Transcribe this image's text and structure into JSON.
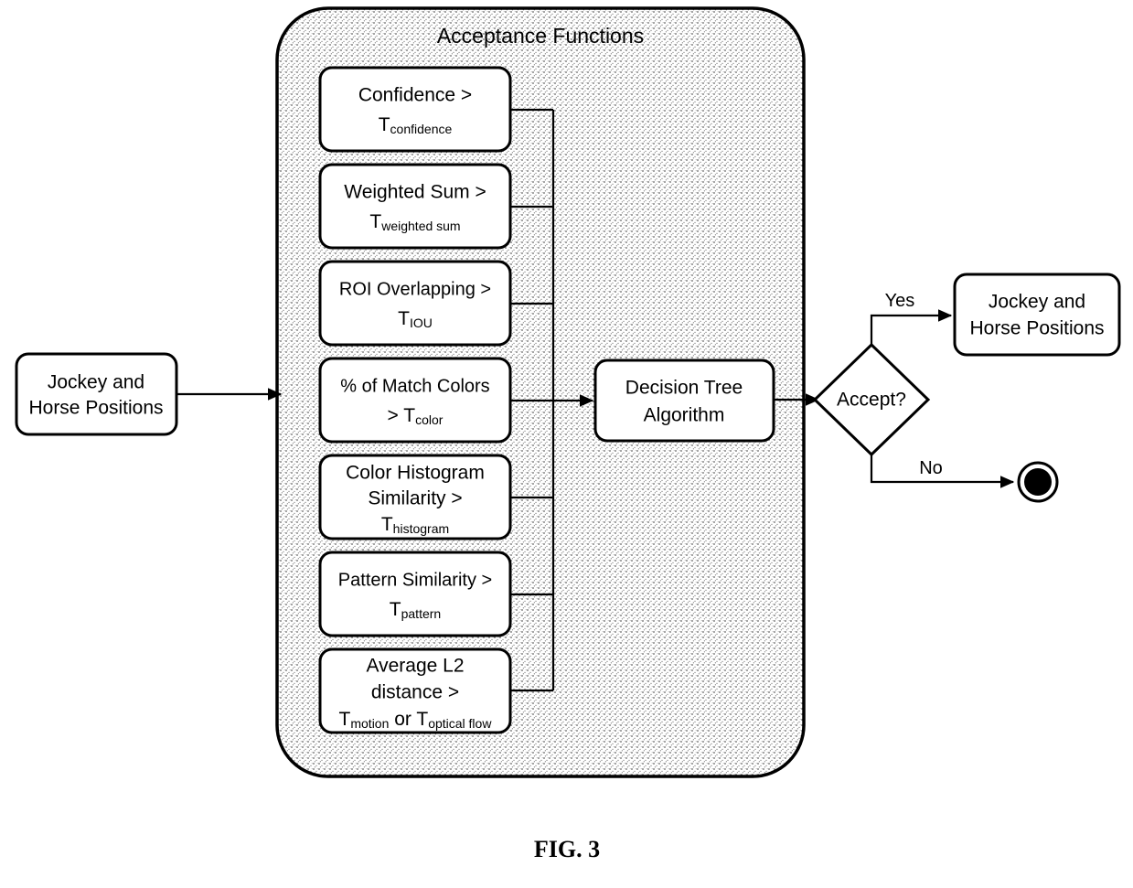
{
  "figure": {
    "caption": "FIG. 3",
    "colors": {
      "stroke": "#000000",
      "background": "#ffffff",
      "container_fill": "#e8e8e8"
    }
  },
  "input_node": {
    "name": "jockey-horse-positions-input",
    "lines": [
      "Jockey and",
      "Horse Positions"
    ]
  },
  "group": {
    "title": "Acceptance Functions",
    "functions": [
      {
        "id": "confidence",
        "lines": [
          {
            "text": "Confidence >",
            "sub": ""
          },
          {
            "text": "T",
            "sub": "confidence"
          }
        ]
      },
      {
        "id": "weighted-sum",
        "lines": [
          {
            "text": "Weighted Sum >",
            "sub": ""
          },
          {
            "text": "T",
            "sub": "weighted sum"
          }
        ]
      },
      {
        "id": "roi-overlapping",
        "lines": [
          {
            "text": "ROI Overlapping >",
            "sub": ""
          },
          {
            "text": "T",
            "sub": "IOU"
          }
        ]
      },
      {
        "id": "match-colors",
        "lines": [
          {
            "text": "% of Match Colors",
            "sub": ""
          },
          {
            "text": "> T",
            "sub": "color"
          }
        ]
      },
      {
        "id": "color-histogram",
        "lines": [
          {
            "text": "Color Histogram",
            "sub": ""
          },
          {
            "text": "Similarity >",
            "sub": ""
          },
          {
            "text": "T",
            "sub": "histogram"
          }
        ]
      },
      {
        "id": "pattern-similarity",
        "lines": [
          {
            "text": "Pattern Similarity >",
            "sub": ""
          },
          {
            "text": "T",
            "sub": "pattern"
          }
        ]
      },
      {
        "id": "average-l2-distance",
        "lines": [
          {
            "text": "Average L2",
            "sub": ""
          },
          {
            "text": "distance >",
            "sub": ""
          },
          {
            "text": "T",
            "sub": "motion",
            "text2": " or T",
            "sub2": "optical flow"
          }
        ]
      }
    ]
  },
  "decision_tree_node": {
    "name": "decision-tree-algorithm",
    "lines": [
      "Decision Tree",
      "Algorithm"
    ]
  },
  "decision": {
    "name": "accept-decision",
    "label": "Accept?",
    "branches": {
      "yes": "Yes",
      "no": "No"
    }
  },
  "output_node": {
    "name": "jockey-horse-positions-output",
    "lines": [
      "Jockey and",
      "Horse Positions"
    ]
  },
  "end_node": {
    "name": "end-node",
    "label": ""
  }
}
